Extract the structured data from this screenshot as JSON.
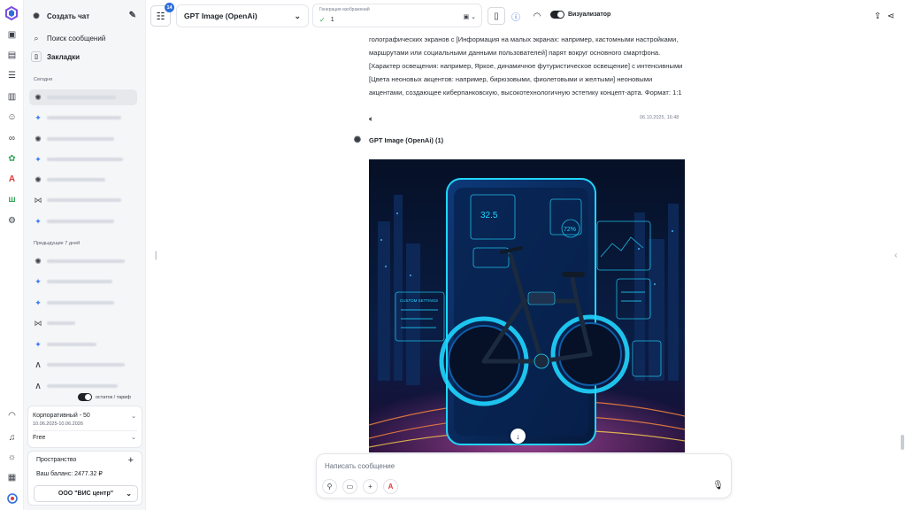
{
  "colors": {
    "accent": "#2f6fdb",
    "badge_bg": "#2f6fdb",
    "check": "#3aa55a",
    "neon": "#20d6ff"
  },
  "rail": {
    "icons": [
      "app-logo-icon",
      "image-icon",
      "gallery-icon",
      "list-icon",
      "briefcase-icon",
      "users-icon",
      "infinity-icon",
      "puzzle-icon",
      "letter-a-icon",
      "wildberries-icon",
      "gear-icon",
      "headset-icon",
      "bell-icon",
      "sun-icon",
      "document-icon",
      "support-logo-icon"
    ]
  },
  "sidebar": {
    "new_chat": "Создать чат",
    "search": "Поиск сообщений",
    "bookmarks": "Закладки",
    "section_today": "Сегодня",
    "section_week": "Предыдущие 7 дней",
    "today_icons": [
      "gpt",
      "gem",
      "gpt",
      "gem",
      "gpt",
      "cl",
      "gem",
      "gem"
    ],
    "week_icons": [
      "gpt",
      "gem",
      "gem",
      "cl",
      "gem",
      "al",
      "al"
    ],
    "toggle_label": "остаток / тариф",
    "tariff": {
      "name": "Корпоративный - 50",
      "period": "10.06.2025-10.06.2026",
      "plan": "Free"
    },
    "space": {
      "title": "Пространство",
      "balance": "Ваш баланс: 2477.32 ₽",
      "org": "ООО \"ВИС центр\""
    }
  },
  "topbar": {
    "filter_badge": "14",
    "model": "GPT Image (OpenAi)",
    "gen_label": "Генерация изображений",
    "gen_value": "1",
    "visualizer": "Визуализатор"
  },
  "chat": {
    "user_message": "голографических экранов с [Информация на малых экранах: например, кастомными настройками, маршрутами или социальными данными пользователей] парят вокруг основного смартфона. [Характер освещения: например, Яркое, динамичное футуристическое освещение] с интенсивными [Цвета неоновых акцентов: например, бирюзовыми, фиолетовыми и желтыми] неоновыми акцентами, создающее киберпанковскую, высокотехнологичную эстетику концепт-арта. Формат: 1:1",
    "user_time": "06.10.2025, 16:48",
    "bot_name": "GPT Image (OpenAi) (1)"
  },
  "image": {
    "screen_readout_1": "32.5",
    "screen_readout_2": "72%",
    "panel_label": "CUSTOM SETTINGS"
  },
  "composer": {
    "placeholder": "Написать сообщение"
  }
}
